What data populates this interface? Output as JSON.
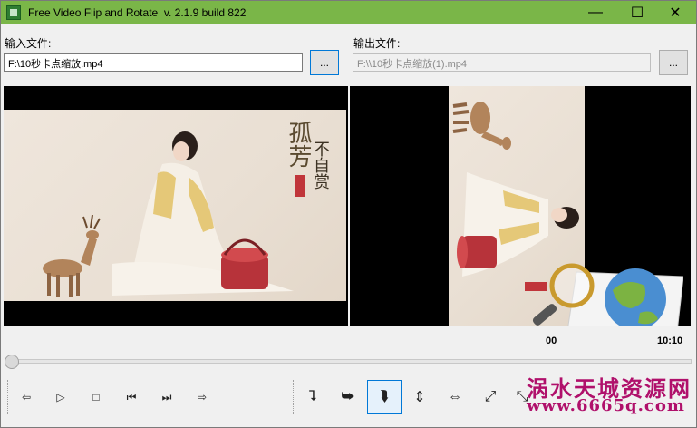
{
  "app": {
    "title": "Free Video Flip and Rotate  v. 2.1.9 build 822"
  },
  "window_controls": {
    "minimize": "—",
    "maximize": "☐",
    "close": "✕"
  },
  "input": {
    "label": "输入文件:",
    "value": "F:\\10秒卡点缩放.mp4",
    "browse_label": "..."
  },
  "output": {
    "label": "输出文件:",
    "value": "F:\\\\10秒卡点缩放(1).mp4",
    "browse_label": "..."
  },
  "playback": {
    "time_current": "00",
    "time_total": "10:10"
  },
  "player_controls": {
    "rewind": "⇦",
    "play": "▷",
    "stop": "□",
    "prev": "⏮",
    "next": "⏭",
    "forward": "⇨"
  },
  "transform_controls": {
    "rotate_ccw": "⮧",
    "rotate_cw": "⮩",
    "rotate_180": "⮯",
    "flip_vertical": "⇕",
    "flip_horizontal": "⇔",
    "rotate_diag": "⤢",
    "rotate_diag2": "⤡"
  },
  "watermark": {
    "text": "涡水天城资源网",
    "url": "www.6665q.com"
  },
  "artwork": {
    "calligraphy_1": "孤芳",
    "calligraphy_2": "不自赏"
  }
}
